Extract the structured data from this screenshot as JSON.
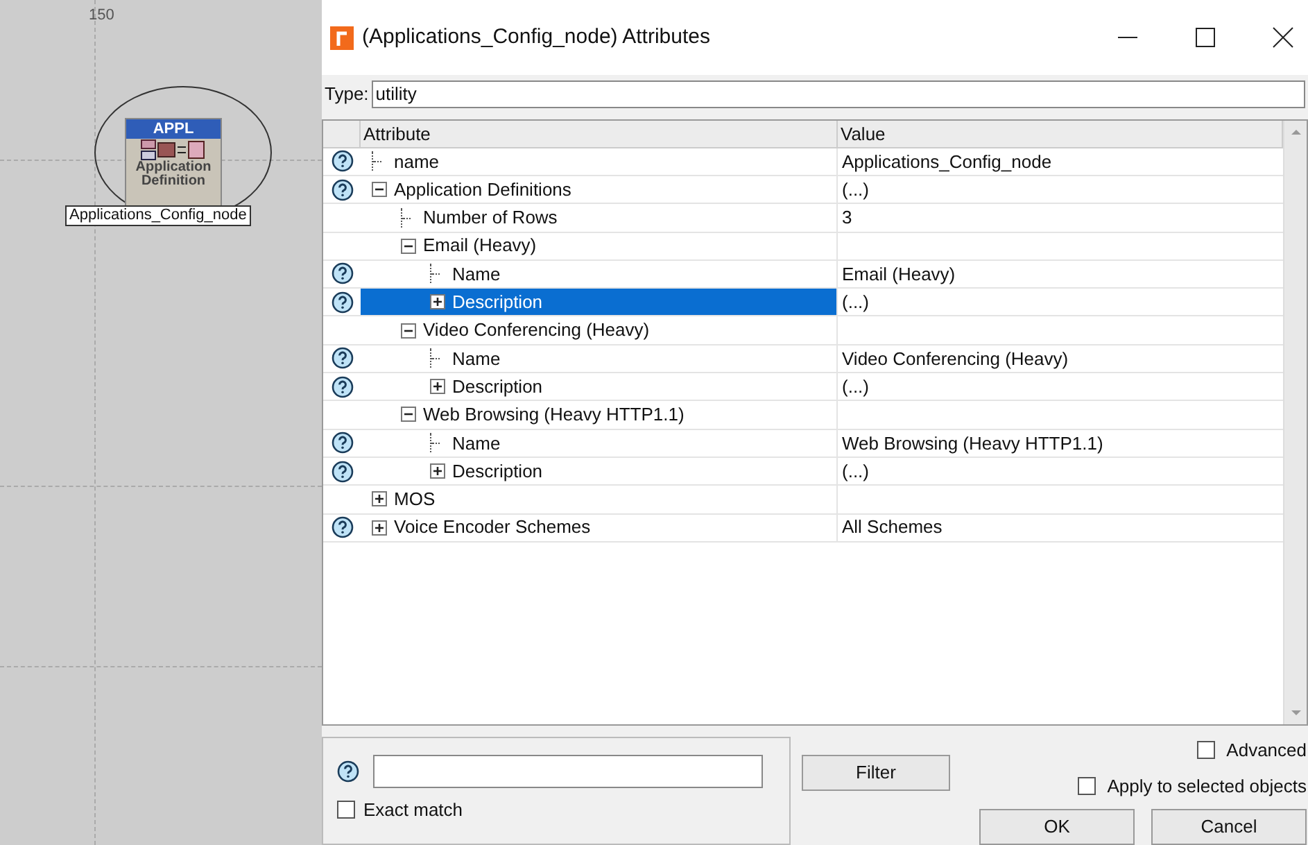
{
  "canvas": {
    "ruler_label": "150",
    "node": {
      "badge": "APPL",
      "caption": "Application Definition",
      "label": "Applications_Config_node"
    }
  },
  "window": {
    "title": "(Applications_Config_node) Attributes"
  },
  "type_field": {
    "label": "Type:",
    "value": "utility"
  },
  "table": {
    "columns": [
      "Attribute",
      "Value"
    ],
    "rows": [
      {
        "attribute": "name",
        "value": "Applications_Config_node",
        "help": true,
        "selected": false
      },
      {
        "attribute": "Application Definitions",
        "value": "(...)",
        "help": true,
        "selected": false,
        "expanded": true,
        "children": [
          {
            "attribute": "Number of Rows",
            "value": "3",
            "help": false,
            "selected": false
          },
          {
            "attribute": "Email (Heavy)",
            "help": false,
            "selected": false,
            "expanded": true,
            "children": [
              {
                "attribute": "Name",
                "value": "Email (Heavy)",
                "help": true,
                "selected": false
              },
              {
                "attribute": "Description",
                "value": "(...)",
                "help": true,
                "selected": true,
                "expanded": false
              }
            ]
          },
          {
            "attribute": "Video Conferencing (Heavy)",
            "help": false,
            "selected": false,
            "expanded": true,
            "children": [
              {
                "attribute": "Name",
                "value": "Video Conferencing (Heavy)",
                "help": true,
                "selected": false
              },
              {
                "attribute": "Description",
                "value": "(...)",
                "help": true,
                "selected": false,
                "expanded": false
              }
            ]
          },
          {
            "attribute": "Web Browsing (Heavy HTTP1.1)",
            "help": false,
            "selected": false,
            "expanded": true,
            "children": [
              {
                "attribute": "Name",
                "value": "Web Browsing (Heavy HTTP1.1)",
                "help": true,
                "selected": false
              },
              {
                "attribute": "Description",
                "value": "(...)",
                "help": true,
                "selected": false,
                "expanded": false
              }
            ]
          }
        ]
      },
      {
        "attribute": "MOS",
        "help": false,
        "selected": false,
        "expanded": false
      },
      {
        "attribute": "Voice Encoder Schemes",
        "value": "All Schemes",
        "help": true,
        "selected": false,
        "expanded": false
      }
    ]
  },
  "filter": {
    "button": "Filter",
    "exact_match": {
      "label": "Exact match",
      "checked": false
    }
  },
  "options": [
    {
      "label": "Advanced",
      "checked": false
    },
    {
      "label": "Apply to selected objects",
      "checked": false
    }
  ],
  "buttons": [
    "OK",
    "Cancel"
  ]
}
